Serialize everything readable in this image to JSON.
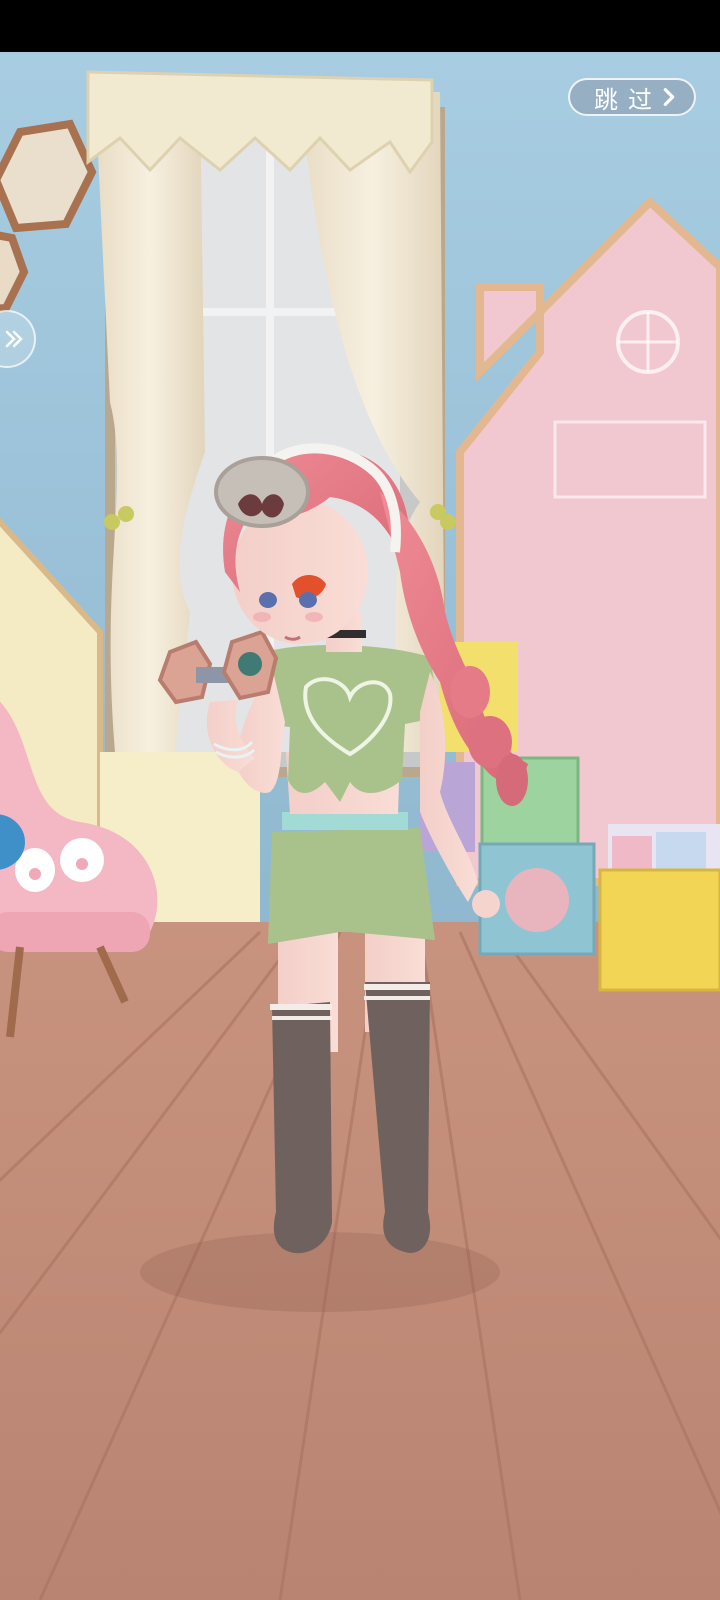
{
  "status_bar": {},
  "scene": {
    "description_icon": "character-room-scene",
    "colors": {
      "wall": "#9cc3da",
      "floor": "#c4917c",
      "curtain": "#efe6d2",
      "pink_panel": "#f2c9d0",
      "hair": "#e27a86",
      "outfit": "#a9c28c"
    }
  },
  "skip_button": {
    "label": "跳过",
    "icon": "chevron-right-icon"
  },
  "side_button": {
    "icon": "double-chevron-right-icon"
  }
}
